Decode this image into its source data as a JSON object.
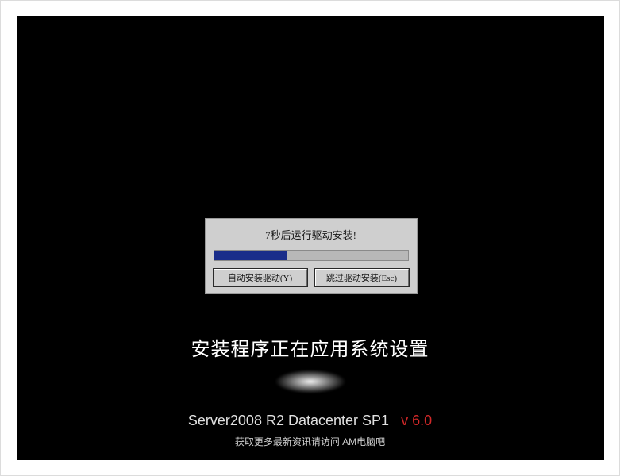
{
  "dialog": {
    "message": "7秒后运行驱动安装!",
    "progress_percent": 38,
    "button_install": "自动安装驱动(Y)",
    "button_skip": "跳过驱动安装(Esc)"
  },
  "status_text": "安装程序正在应用系统设置",
  "footer": {
    "product": "Server2008 R2  Datacenter SP1",
    "version": "v 6.0",
    "tagline": "获取更多最新资讯请访问 AM电脑吧"
  },
  "colors": {
    "background": "#000000",
    "dialog_bg": "#cfcfcf",
    "progress_fill": "#1a2d8a",
    "version_color": "#d02828"
  }
}
